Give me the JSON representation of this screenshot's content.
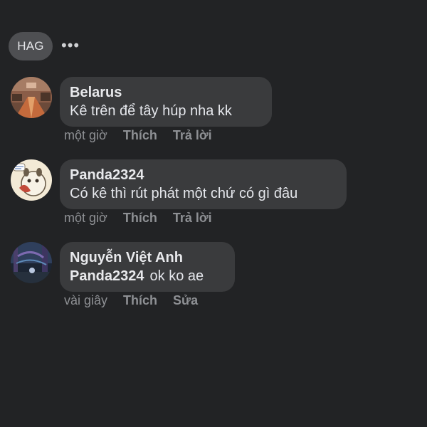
{
  "top": {
    "chip_label": "HAG",
    "more_label": "•••"
  },
  "comments": [
    {
      "author": "Belarus",
      "text": "Kê trên để tây húp nha kk",
      "time": "một giờ",
      "like": "Thích",
      "reply": "Trả lời"
    },
    {
      "author": "Panda2324",
      "text": "Có kê thì rút phát một chứ có gì đâu",
      "time": "một giờ",
      "like": "Thích",
      "reply": "Trả lời"
    },
    {
      "author": "Nguyễn Việt Anh",
      "mention": "Panda2324",
      "text": "ok ko ae",
      "time": "vài giây",
      "like": "Thích",
      "edit": "Sửa"
    }
  ],
  "colors": {
    "background": "#222325",
    "bubble": "#3a3b3d",
    "chip": "#4e4f52",
    "meta_text": "#8e9094"
  }
}
